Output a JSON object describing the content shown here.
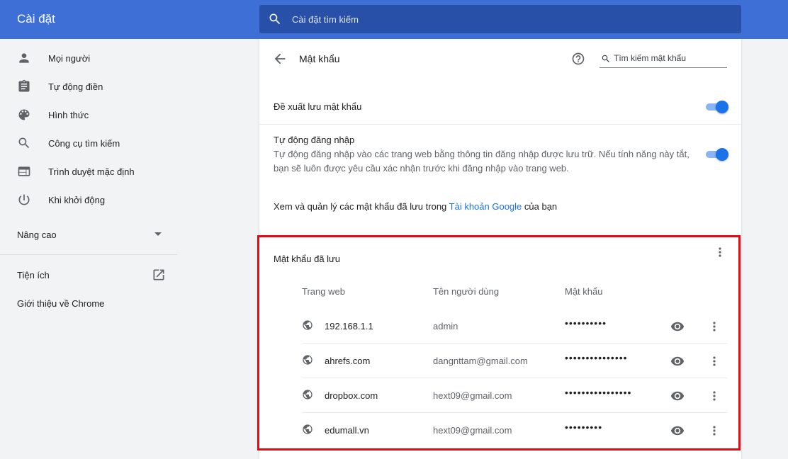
{
  "header": {
    "app_title": "Cài đặt",
    "search_placeholder": "Cài đặt tìm kiếm"
  },
  "sidebar": {
    "items": [
      {
        "label": "Mọi người",
        "icon": "person-icon"
      },
      {
        "label": "Tự động điền",
        "icon": "clipboard-icon"
      },
      {
        "label": "Hình thức",
        "icon": "palette-icon"
      },
      {
        "label": "Công cụ tìm kiếm",
        "icon": "search-icon"
      },
      {
        "label": "Trình duyệt mặc định",
        "icon": "browser-icon"
      },
      {
        "label": "Khi khởi động",
        "icon": "power-icon"
      }
    ],
    "advanced_label": "Nâng cao",
    "extensions_label": "Tiện ích",
    "about_label": "Giới thiệu về Chrome"
  },
  "passwords": {
    "title": "Mật khẩu",
    "search_placeholder": "Tìm kiếm mật khẩu",
    "offer_save_label": "Đề xuất lưu mật khẩu",
    "offer_save_enabled": true,
    "auto_signin_label": "Tự động đăng nhập",
    "auto_signin_desc_line1": "Tự động đăng nhập vào các trang web bằng thông tin đăng nhập được lưu trữ. Nếu tính năng này tắt,",
    "auto_signin_desc_line2": "bạn sẽ luôn được yêu cầu xác nhận trước khi đăng nhập vào trang web.",
    "auto_signin_enabled": true,
    "account_text_before": "Xem và quản lý các mật khẩu đã lưu trong ",
    "account_link": "Tài khoản Google",
    "account_text_after": " của bạn",
    "saved_title": "Mật khẩu đã lưu",
    "columns": {
      "site": "Trang web",
      "username": "Tên người dùng",
      "password": "Mật khẩu"
    },
    "rows": [
      {
        "site": "192.168.1.1",
        "username": "admin",
        "password": "••••••••••"
      },
      {
        "site": "ahrefs.com",
        "username": "dangnttam@gmail.com",
        "password": "•••••••••••••••"
      },
      {
        "site": "dropbox.com",
        "username": "hext09@gmail.com",
        "password": "••••••••••••••••"
      },
      {
        "site": "edumall.vn",
        "username": "hext09@gmail.com",
        "password": "•••••••••"
      }
    ]
  },
  "colors": {
    "topbar": "#3d6fd6",
    "search_bg": "#2850a8",
    "accent": "#1a73e8",
    "highlight_border": "#e50914"
  }
}
